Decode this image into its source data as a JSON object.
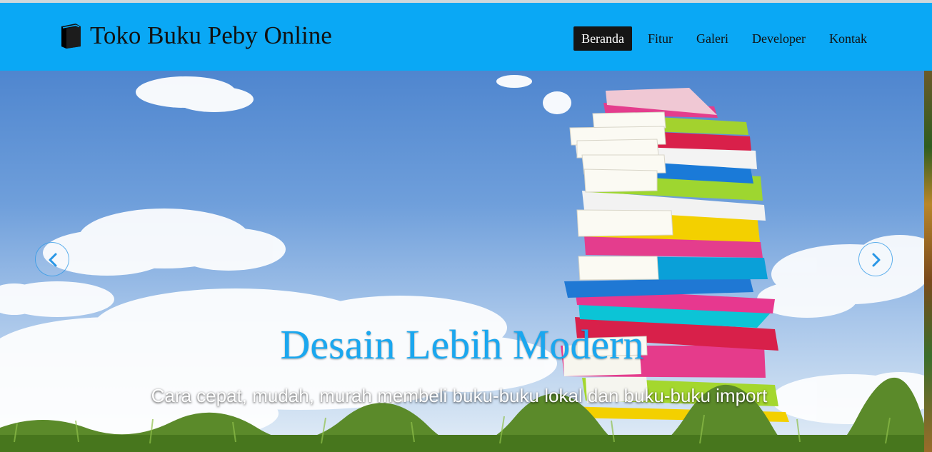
{
  "brand": {
    "title": "Toko Buku Peby Online",
    "icon": "book-icon"
  },
  "nav": {
    "items": [
      {
        "label": "Beranda",
        "active": true
      },
      {
        "label": "Fitur",
        "active": false
      },
      {
        "label": "Galeri",
        "active": false
      },
      {
        "label": "Developer",
        "active": false
      },
      {
        "label": "Kontak",
        "active": false
      }
    ]
  },
  "carousel": {
    "title": "Desain Lebih Modern",
    "subtitle": "Cara cepat, mudah, murah membeli buku-buku lokal dan buku-buku import",
    "prev_icon": "chevron-left-icon",
    "next_icon": "chevron-right-icon"
  },
  "colors": {
    "navbar": "#0aa8f5",
    "active_nav": "#151515",
    "caption_title": "#1aa7ef",
    "control_ring": "#2896e6"
  }
}
